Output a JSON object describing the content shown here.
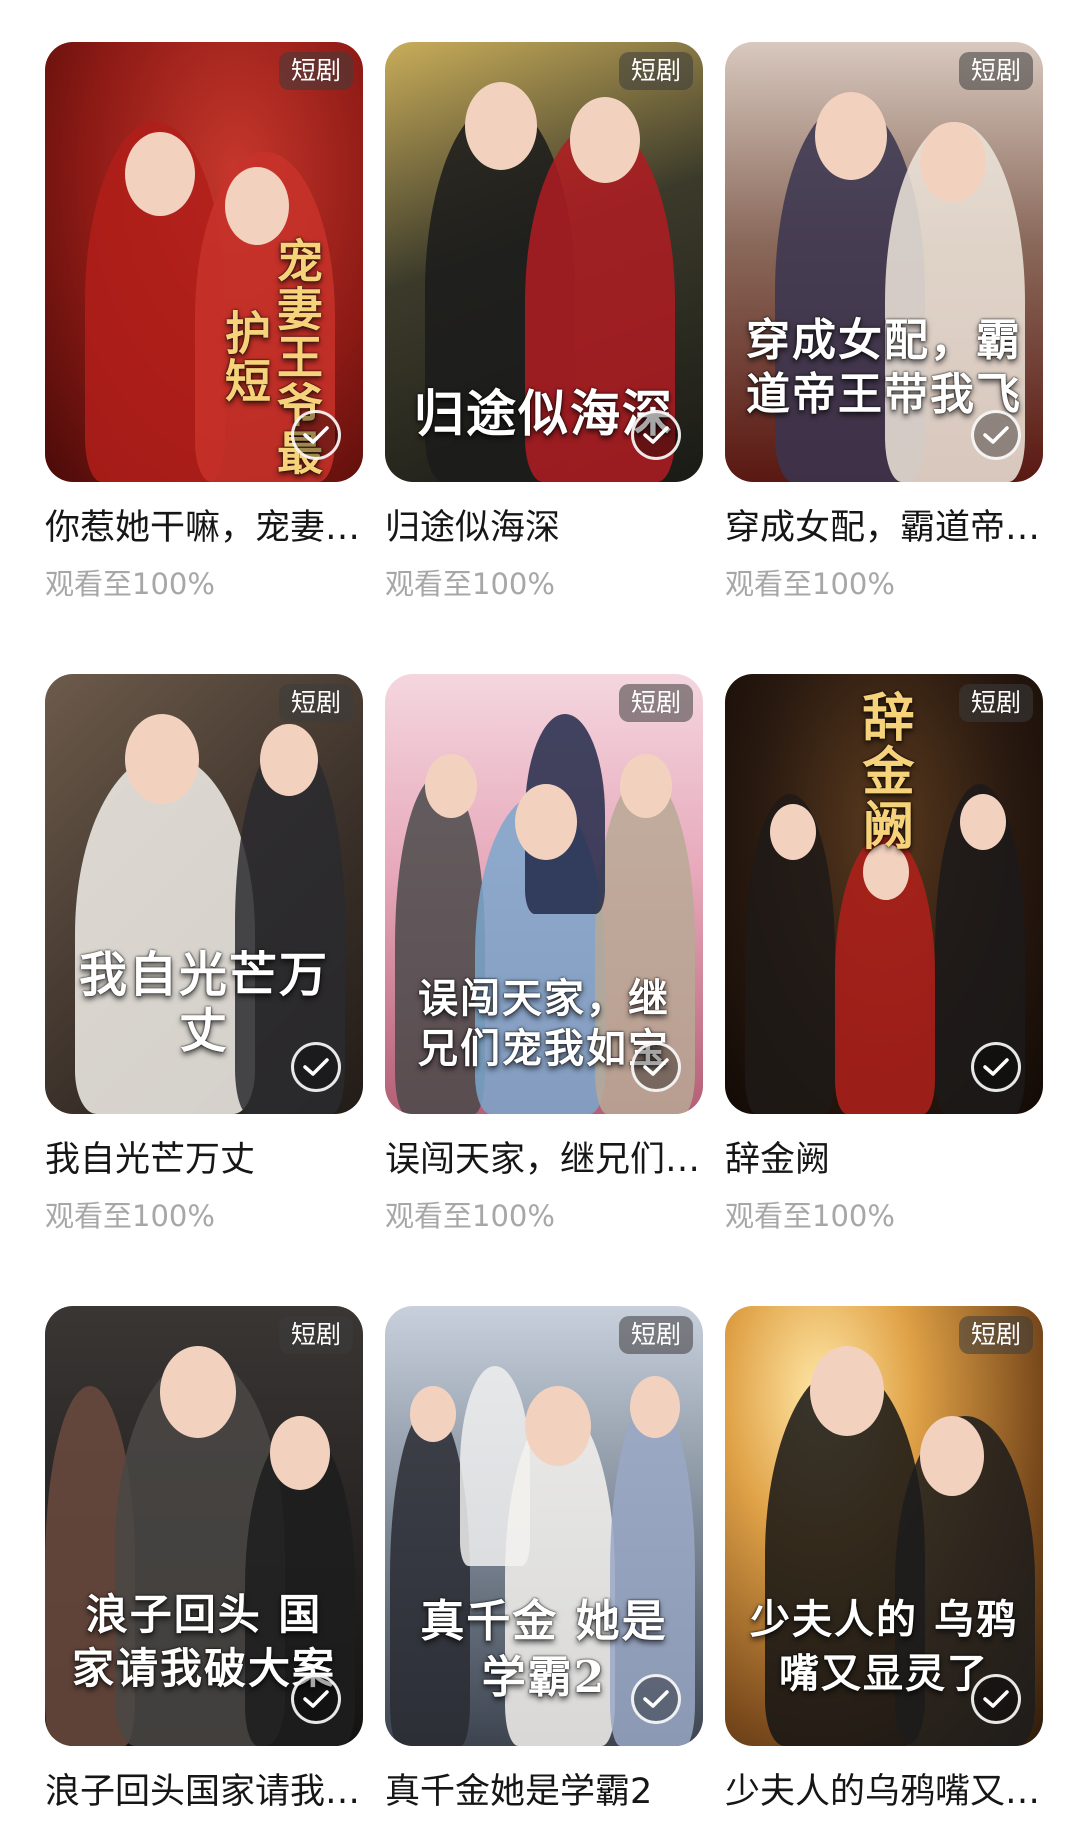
{
  "badge_label": "短剧",
  "items": [
    {
      "title": "你惹她干嘛，宠妻王爷最护短",
      "poster_text": "宠妻王爷最护短",
      "progress": "观看至100%"
    },
    {
      "title": "归途似海深",
      "poster_text": "归途似海深",
      "progress": "观看至100%"
    },
    {
      "title": "穿成女配，霸道帝王带我飞",
      "poster_text": "穿成女配，霸道帝王带我飞",
      "progress": "观看至100%"
    },
    {
      "title": "我自光芒万丈",
      "poster_text": "我自光芒万丈",
      "progress": "观看至100%"
    },
    {
      "title": "误闯天家，继兄们宠我如宝",
      "poster_text": "误闯天家，继兄们宠我如宝",
      "progress": "观看至100%"
    },
    {
      "title": "辞金阙",
      "poster_text": "辞金阙",
      "progress": "观看至100%"
    },
    {
      "title": "浪子回头国家请我破大案",
      "poster_text": "浪子回头 国家请我破大案",
      "progress": ""
    },
    {
      "title": "真千金她是学霸2",
      "poster_text": "真千金 她是学霸2",
      "progress": ""
    },
    {
      "title": "少夫人的乌鸦嘴又显灵了",
      "poster_text": "少夫人的 乌鸦嘴又显灵了",
      "progress": ""
    }
  ],
  "colors": {
    "badge_bg": "#3c3c3c",
    "title_text": "#161616",
    "progress_text": "#a7a7a7"
  },
  "icons": {
    "check": "checkmark-icon"
  }
}
